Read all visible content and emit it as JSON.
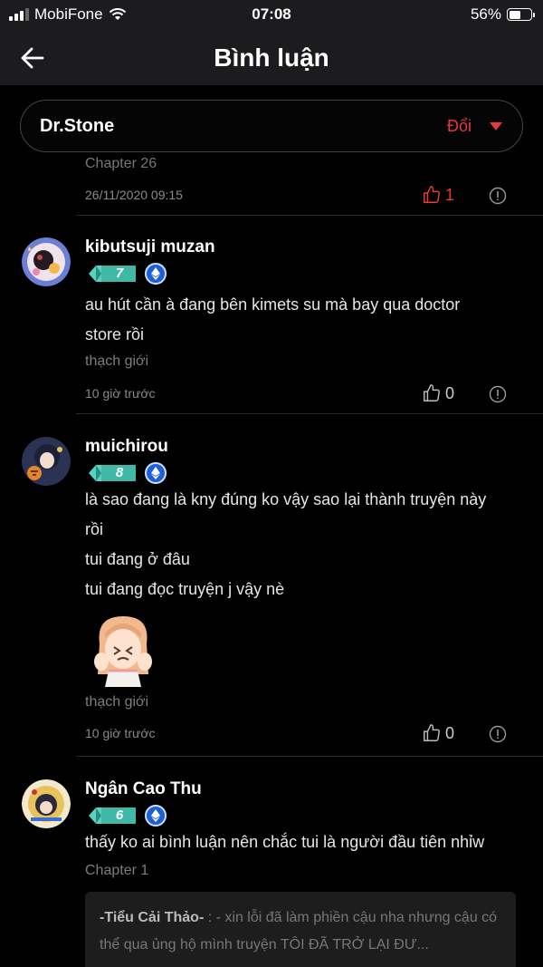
{
  "status_bar": {
    "carrier": "MobiFone",
    "time": "07:08",
    "battery": "56%",
    "battery_level": 0.56
  },
  "header": {
    "title": "Bình luận"
  },
  "selector": {
    "series": "Dr.Stone",
    "change_label": "Đổi"
  },
  "top_partial": {
    "chapter": "Chapter 26",
    "time": "26/11/2020 09:15",
    "likes": "1"
  },
  "comments": [
    {
      "username": "kibutsuji muzan",
      "level": "7",
      "lines": [
        "au hút cần à đang bên kimets su mà bay qua doctor",
        "store rồi"
      ],
      "rank": "thạch giới",
      "time": "10 giờ trước",
      "likes": "0"
    },
    {
      "username": "muichirou",
      "level": "8",
      "lines": [
        "là sao đang là kny đúng ko vậy sao lại thành truyện này",
        "rồi",
        "tui đang ở đâu",
        "tui đang đọc truyện j vậy nè"
      ],
      "rank": "thạch giới",
      "time": "10 giờ trước",
      "likes": "0"
    },
    {
      "username": "Ngân Cao Thu",
      "level": "6",
      "lines": [
        "thấy ko ai bình luận nên chắc tui là người đầu tiên nhỉw"
      ],
      "chapter": "Chapter 1",
      "reply": {
        "author": "-Tiểu Cải Thảo-",
        "text": ": - xin lỗi đã làm phiền cậu nha nhưng cậu có thể qua ủng hộ mình truyện TÔI ĐÃ TRỞ LẠI ĐƯ..."
      }
    }
  ],
  "colors": {
    "accent": "#e83a3a",
    "level_badge": "#3fb8a6",
    "chain_badge": "#1e5fd6"
  }
}
